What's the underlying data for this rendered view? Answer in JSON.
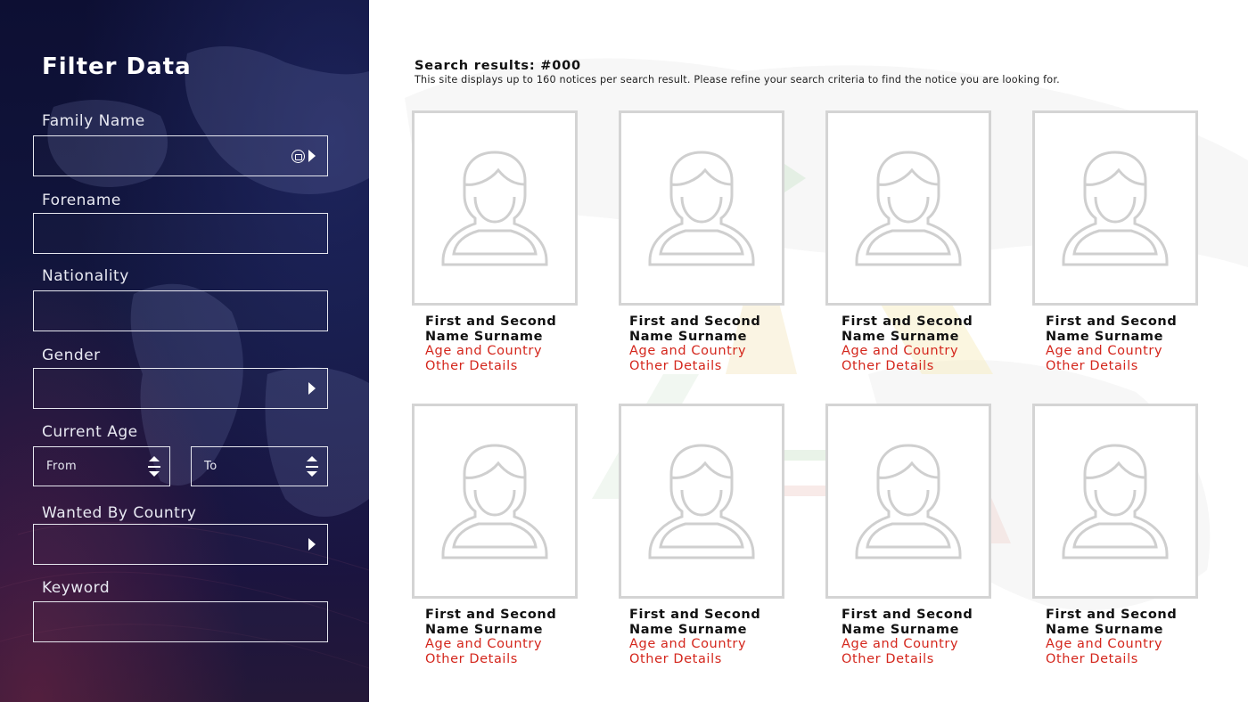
{
  "sidebar": {
    "title": "Filter Data",
    "fields": {
      "family_name": {
        "label": "Family Name",
        "value": ""
      },
      "forename": {
        "label": "Forename",
        "value": ""
      },
      "nationality": {
        "label": "Nationality",
        "value": ""
      },
      "gender": {
        "label": "Gender",
        "value": ""
      },
      "current_age": {
        "label": "Current Age",
        "from_placeholder": "From",
        "to_placeholder": "To"
      },
      "wanted_by_country": {
        "label": "Wanted By Country",
        "value": ""
      },
      "keyword": {
        "label": "Keyword",
        "value": ""
      }
    }
  },
  "results": {
    "title": "Search results: #000",
    "subtitle": "This site displays up to 160 notices per search result. Please refine your search criteria to find the notice you are looking for."
  },
  "cards": [
    {
      "name_line1": "First and Second",
      "name_line2": "Name Surname",
      "detail_line1": "Age and Country",
      "detail_line2": "Other Details",
      "icon": "person-placeholder-icon"
    },
    {
      "name_line1": "First and Second",
      "name_line2": "Name Surname",
      "detail_line1": "Age and Country",
      "detail_line2": "Other Details",
      "icon": "person-placeholder-icon"
    },
    {
      "name_line1": "First and Second",
      "name_line2": "Name Surname",
      "detail_line1": "Age and Country",
      "detail_line2": "Other Details",
      "icon": "person-placeholder-icon"
    },
    {
      "name_line1": "First and Second",
      "name_line2": "Name Surname",
      "detail_line1": "Age and Country",
      "detail_line2": "Other Details",
      "icon": "person-placeholder-icon"
    },
    {
      "name_line1": "First and Second",
      "name_line2": "Name Surname",
      "detail_line1": "Age and Country",
      "detail_line2": "Other Details",
      "icon": "person-placeholder-icon"
    },
    {
      "name_line1": "First and Second",
      "name_line2": "Name Surname",
      "detail_line1": "Age and Country",
      "detail_line2": "Other Details",
      "icon": "person-placeholder-icon"
    },
    {
      "name_line1": "First and Second",
      "name_line2": "Name Surname",
      "detail_line1": "Age and Country",
      "detail_line2": "Other Details",
      "icon": "person-placeholder-icon"
    },
    {
      "name_line1": "First and Second",
      "name_line2": "Name Surname",
      "detail_line1": "Age and Country",
      "detail_line2": "Other Details",
      "icon": "person-placeholder-icon"
    }
  ],
  "colors": {
    "sidebar_bg": "#0d0f33",
    "name_text": "#111111",
    "detail_text": "#d4261c",
    "card_border": "#d4d4d4"
  }
}
